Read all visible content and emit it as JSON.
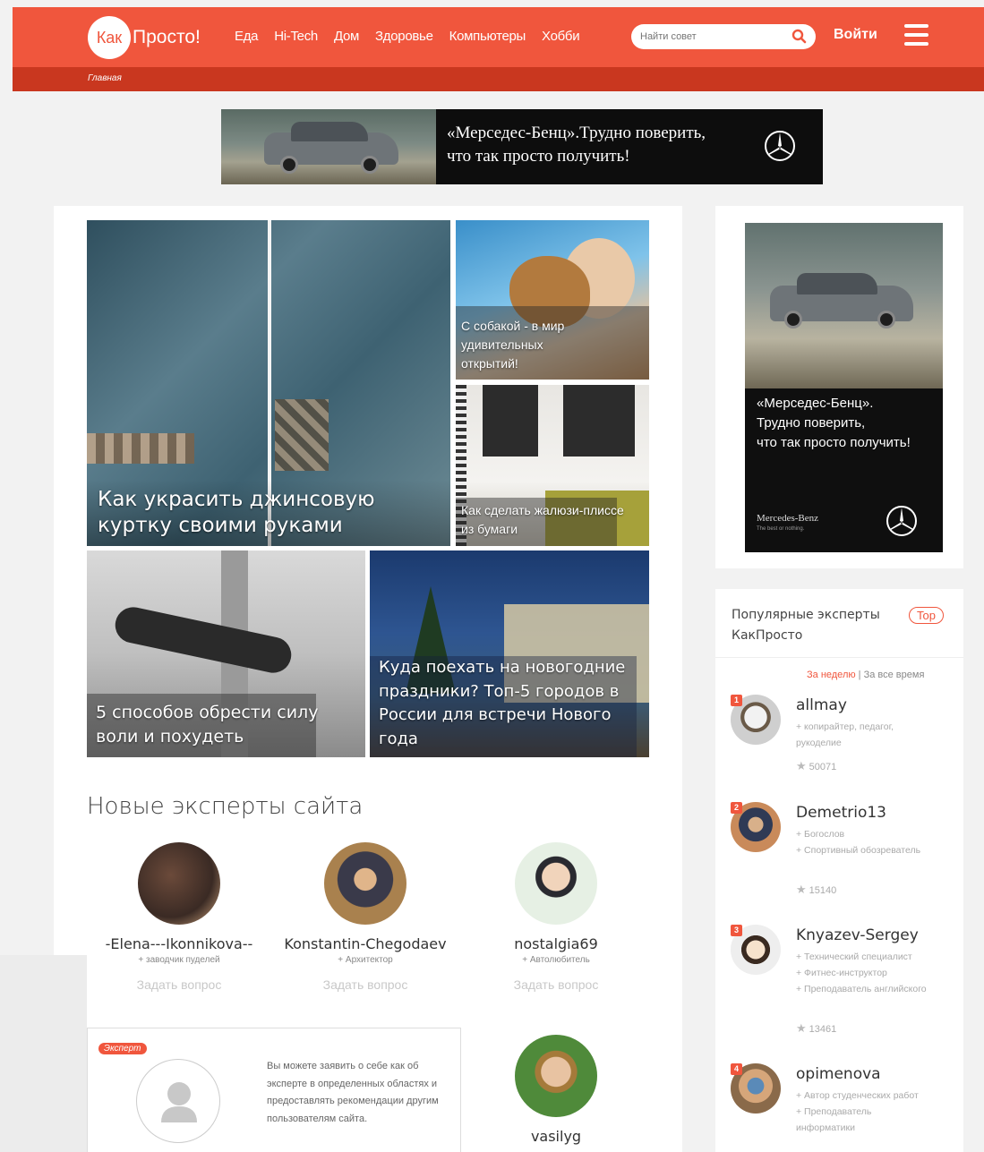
{
  "header": {
    "logo_bubble": "Как",
    "logo_text": "Просто!",
    "nav": [
      "Еда",
      "Hi-Tech",
      "Дом",
      "Здоровье",
      "Компьютеры",
      "Хобби"
    ],
    "search_placeholder": "Найти совет",
    "login": "Войти",
    "brand_color": "#f0563d"
  },
  "breadcrumb": "Главная",
  "banner": {
    "line1": "«Мерседес-Бенц».Трудно поверить,",
    "line2": "что так просто получить!"
  },
  "tiles": {
    "jacket": "Как украсить джинсовую куртку своими руками",
    "dog": "С собакой - в мир удивительных открытий!",
    "blinds": "Как сделать жалюзи-плиссе из бумаги",
    "willpower": "5 способов обрести силу воли и похудеть",
    "newyear": "Куда поехать на новогодние праздники? Топ-5 городов в России для встречи Нового года"
  },
  "new_experts": {
    "title": "Новые эксперты сайта",
    "ask_label": "Задать вопрос",
    "items": [
      {
        "name": "-Elena---Ikonnikova--",
        "role": "+ заводчик пуделей"
      },
      {
        "name": "Konstantin-Chegodaev",
        "role": "+ Архитектор"
      },
      {
        "name": "nostalgia69",
        "role": "+ Автолюбитель"
      },
      {
        "name": "vasilyg",
        "role": ""
      }
    ],
    "claim_badge": "Эксперт",
    "claim_text": "Вы можете заявить о себе как об эксперте в определенных областях и предоставлять рекомендации другим пользователям сайта."
  },
  "side_ad": {
    "line1": "«Мерседес-Бенц».",
    "line2": "Трудно поверить,",
    "line3": "что так просто получить!",
    "brand": "Mercedes-Benz",
    "slogan": "The best or nothing."
  },
  "popular": {
    "title": "Популярные эксперты КакПросто",
    "top_label": "Top",
    "period_week": "За неделю",
    "period_sep": " | ",
    "period_all": "За все время",
    "items": [
      {
        "rank": "1",
        "name": "allmay",
        "desc": [
          "+ копирайтер, педагог, рукоделие"
        ],
        "score": "50071"
      },
      {
        "rank": "2",
        "name": "Demetrio13",
        "desc": [
          "+ Богослов",
          "+ Спортивный обозреватель"
        ],
        "score": "15140"
      },
      {
        "rank": "3",
        "name": "Knyazev-Sergey",
        "desc": [
          "+ Технический специалист",
          "+ Фитнес-инструктор",
          "+ Преподаватель английского"
        ],
        "score": "13461"
      },
      {
        "rank": "4",
        "name": "opimenova",
        "desc": [
          "+ Автор студенческих работ",
          "+ Преподаватель информатики"
        ],
        "score": ""
      }
    ]
  }
}
